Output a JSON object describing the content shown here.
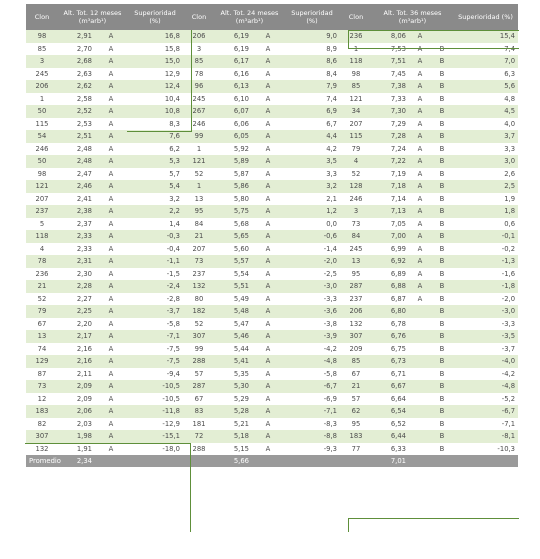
{
  "headers": [
    "Clon",
    "Alt. Tot. 12 meses (m³arb¹)",
    "",
    "Superioridad (%)",
    "Clon",
    "Alt. Tot. 24 meses (m³arb¹)",
    "",
    "Superioridad (%)",
    "Clon",
    "Alt. Tot. 36 meses (m³arb¹)",
    "",
    "",
    "Superioridad (%)"
  ],
  "rows": [
    [
      "98",
      "2,91",
      "A",
      "16,8",
      "206",
      "6,19",
      "A",
      "9,0",
      "236",
      "8,06",
      "A",
      "",
      "15,4"
    ],
    [
      "85",
      "2,70",
      "A",
      "15,8",
      "3",
      "6,19",
      "A",
      "8,9",
      "1",
      "7,53",
      "A",
      "B",
      "7,4"
    ],
    [
      "3",
      "2,68",
      "A",
      "15,0",
      "85",
      "6,17",
      "A",
      "8,6",
      "118",
      "7,51",
      "A",
      "B",
      "7,0"
    ],
    [
      "245",
      "2,63",
      "A",
      "12,9",
      "78",
      "6,16",
      "A",
      "8,4",
      "98",
      "7,45",
      "A",
      "B",
      "6,3"
    ],
    [
      "206",
      "2,62",
      "A",
      "12,4",
      "96",
      "6,13",
      "A",
      "7,9",
      "85",
      "7,38",
      "A",
      "B",
      "5,6"
    ],
    [
      "1",
      "2,58",
      "A",
      "10,4",
      "245",
      "6,10",
      "A",
      "7,4",
      "121",
      "7,33",
      "A",
      "B",
      "4,8"
    ],
    [
      "50",
      "2,52",
      "A",
      "10,8",
      "267",
      "6,07",
      "A",
      "6,9",
      "34",
      "7,30",
      "A",
      "B",
      "4,5"
    ],
    [
      "115",
      "2,53",
      "A",
      "8,3",
      "246",
      "6,06",
      "A",
      "6,7",
      "207",
      "7,29",
      "A",
      "B",
      "4,0"
    ],
    [
      "54",
      "2,51",
      "A",
      "7,6",
      "99",
      "6,05",
      "A",
      "4,4",
      "115",
      "7,28",
      "A",
      "B",
      "3,7"
    ],
    [
      "246",
      "2,48",
      "A",
      "6,2",
      "1",
      "5,92",
      "A",
      "4,2",
      "79",
      "7,24",
      "A",
      "B",
      "3,3"
    ],
    [
      "50",
      "2,48",
      "A",
      "5,3",
      "121",
      "5,89",
      "A",
      "3,5",
      "4",
      "7,22",
      "A",
      "B",
      "3,0"
    ],
    [
      "98",
      "2,47",
      "A",
      "5,7",
      "52",
      "5,87",
      "A",
      "3,3",
      "52",
      "7,19",
      "A",
      "B",
      "2,6"
    ],
    [
      "121",
      "2,46",
      "A",
      "5,4",
      "1",
      "5,86",
      "A",
      "3,2",
      "128",
      "7,18",
      "A",
      "B",
      "2,5"
    ],
    [
      "207",
      "2,41",
      "A",
      "3,2",
      "13",
      "5,80",
      "A",
      "2,1",
      "246",
      "7,14",
      "A",
      "B",
      "1,9"
    ],
    [
      "237",
      "2,38",
      "A",
      "2,2",
      "95",
      "5,75",
      "A",
      "1,2",
      "3",
      "7,13",
      "A",
      "B",
      "1,8"
    ],
    [
      "5",
      "2,37",
      "A",
      "1,4",
      "84",
      "5,68",
      "A",
      "0,0",
      "73",
      "7,05",
      "A",
      "B",
      "0,6"
    ],
    [
      "118",
      "2,33",
      "A",
      "-0,3",
      "21",
      "5,65",
      "A",
      "-0,6",
      "84",
      "7,00",
      "A",
      "B",
      "-0,1"
    ],
    [
      "4",
      "2,33",
      "A",
      "-0,4",
      "207",
      "5,60",
      "A",
      "-1,4",
      "245",
      "6,99",
      "A",
      "B",
      "-0,2"
    ],
    [
      "78",
      "2,31",
      "A",
      "-1,1",
      "73",
      "5,57",
      "A",
      "-2,0",
      "13",
      "6,92",
      "A",
      "B",
      "-1,3"
    ],
    [
      "236",
      "2,30",
      "A",
      "-1,5",
      "237",
      "5,54",
      "A",
      "-2,5",
      "95",
      "6,89",
      "A",
      "B",
      "-1,6"
    ],
    [
      "21",
      "2,28",
      "A",
      "-2,4",
      "132",
      "5,51",
      "A",
      "-3,0",
      "287",
      "6,88",
      "A",
      "B",
      "-1,8"
    ],
    [
      "52",
      "2,27",
      "A",
      "-2,8",
      "80",
      "5,49",
      "A",
      "-3,3",
      "237",
      "6,87",
      "A",
      "B",
      "-2,0"
    ],
    [
      "79",
      "2,25",
      "A",
      "-3,7",
      "182",
      "5,48",
      "A",
      "-3,6",
      "206",
      "6,80",
      "",
      "B",
      "-3,0"
    ],
    [
      "67",
      "2,20",
      "A",
      "-5,8",
      "52",
      "5,47",
      "A",
      "-3,8",
      "132",
      "6,78",
      "",
      "B",
      "-3,3"
    ],
    [
      "13",
      "2,17",
      "A",
      "-7,1",
      "307",
      "5,46",
      "A",
      "-3,9",
      "307",
      "6,76",
      "",
      "B",
      "-3,5"
    ],
    [
      "74",
      "2,16",
      "A",
      "-7,5",
      "99",
      "5,44",
      "A",
      "-4,2",
      "209",
      "6,75",
      "",
      "B",
      "-3,7"
    ],
    [
      "129",
      "2,16",
      "A",
      "-7,5",
      "288",
      "5,41",
      "A",
      "-4,8",
      "85",
      "6,73",
      "",
      "B",
      "-4,0"
    ],
    [
      "87",
      "2,11",
      "A",
      "-9,4",
      "57",
      "5,35",
      "A",
      "-5,8",
      "67",
      "6,71",
      "",
      "B",
      "-4,2"
    ],
    [
      "73",
      "2,09",
      "A",
      "-10,5",
      "287",
      "5,30",
      "A",
      "-6,7",
      "21",
      "6,67",
      "",
      "B",
      "-4,8"
    ],
    [
      "12",
      "2,09",
      "A",
      "-10,5",
      "67",
      "5,29",
      "A",
      "-6,9",
      "57",
      "6,64",
      "",
      "B",
      "-5,2"
    ],
    [
      "183",
      "2,06",
      "A",
      "-11,8",
      "83",
      "5,28",
      "A",
      "-7,1",
      "62",
      "6,54",
      "",
      "B",
      "-6,7"
    ],
    [
      "82",
      "2,03",
      "A",
      "-12,9",
      "181",
      "5,21",
      "A",
      "-8,3",
      "95",
      "6,52",
      "",
      "B",
      "-7,1"
    ],
    [
      "307",
      "1,98",
      "A",
      "-15,1",
      "72",
      "5,18",
      "A",
      "-8,8",
      "183",
      "6,44",
      "",
      "B",
      "-8,1"
    ],
    [
      "132",
      "1,91",
      "A",
      "-18,0",
      "288",
      "5,15",
      "A",
      "-9,3",
      "77",
      "6,33",
      "",
      "B",
      "-10,3"
    ]
  ],
  "footer": {
    "label": "Promedio",
    "v12": "2,34",
    "v24": "5,66",
    "v36": "7,01"
  }
}
